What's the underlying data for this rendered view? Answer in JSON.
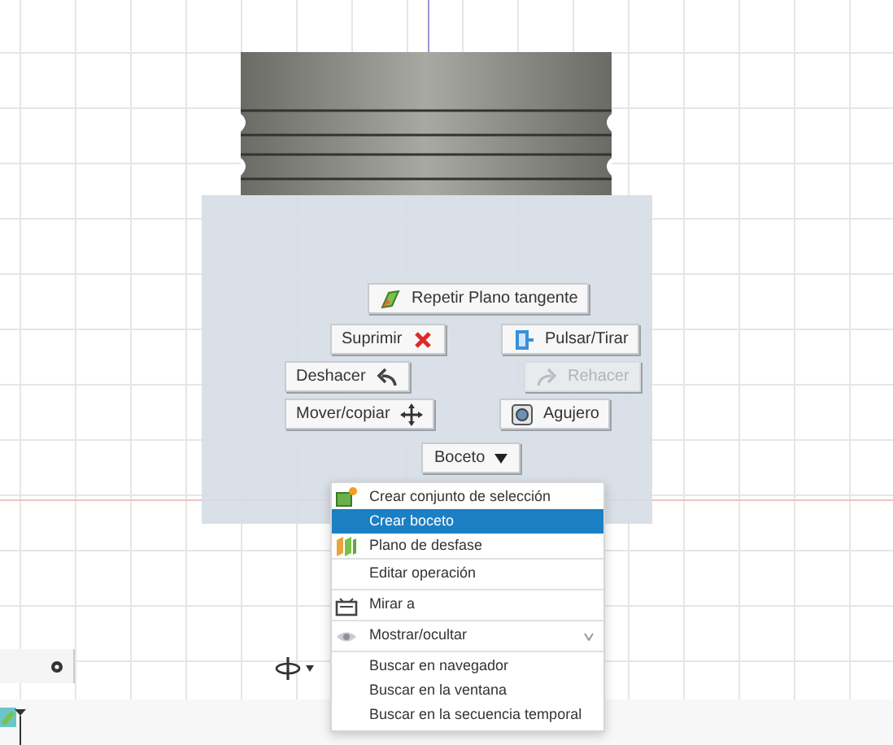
{
  "marking_menu": {
    "buttons": [
      {
        "label": "Repetir Plano tangente",
        "disabled": false
      },
      {
        "label": "Suprimir",
        "disabled": false
      },
      {
        "label": "Pulsar/Tirar",
        "disabled": false
      },
      {
        "label": "Deshacer",
        "disabled": false
      },
      {
        "label": "Rehacer",
        "disabled": true
      },
      {
        "label": "Mover/copiar",
        "disabled": false
      },
      {
        "label": "Agujero",
        "disabled": false
      }
    ],
    "dropdown": {
      "label": "Boceto",
      "expanded": true
    }
  },
  "context_menu": {
    "groups": [
      [
        {
          "label": "Crear conjunto de selección",
          "selected": false,
          "submenu": false
        },
        {
          "label": "Crear boceto",
          "selected": true,
          "submenu": false
        },
        {
          "label": "Plano de desfase",
          "selected": false,
          "submenu": false
        }
      ],
      [
        {
          "label": "Editar operación",
          "selected": false,
          "submenu": false
        }
      ],
      [
        {
          "label": "Mirar a",
          "selected": false,
          "submenu": false
        }
      ],
      [
        {
          "label": "Mostrar/ocultar",
          "selected": false,
          "submenu": true
        }
      ],
      [
        {
          "label": "Buscar en navegador",
          "selected": false,
          "submenu": false
        },
        {
          "label": "Buscar en la ventana",
          "selected": false,
          "submenu": false
        },
        {
          "label": "Buscar en la secuencia temporal",
          "selected": false,
          "submenu": false
        }
      ]
    ]
  }
}
